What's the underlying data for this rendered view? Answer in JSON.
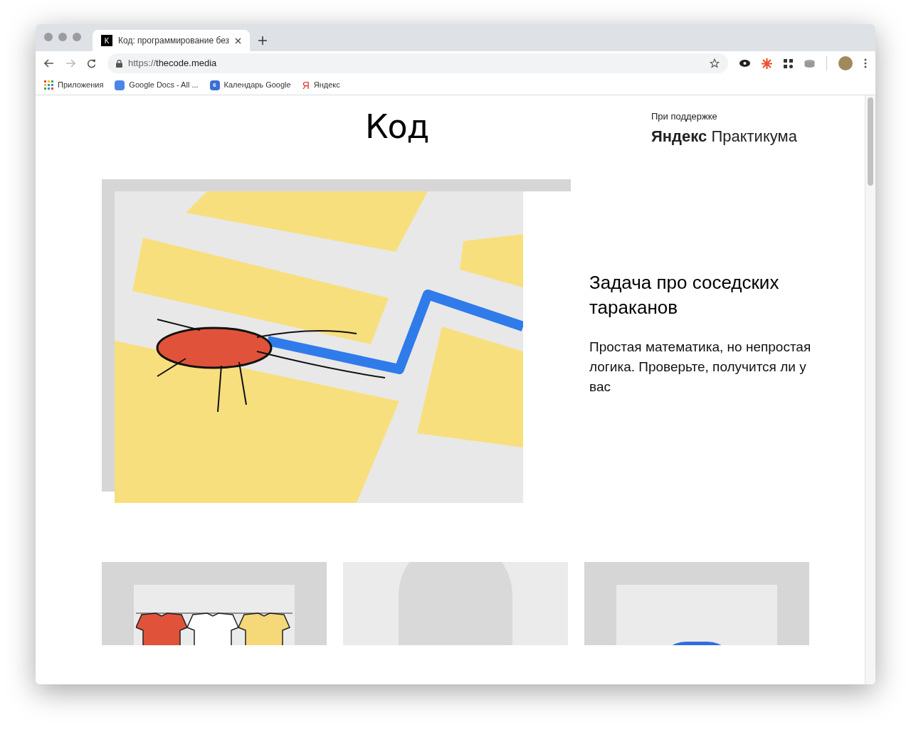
{
  "browser": {
    "tab": {
      "favicon": "K",
      "title": "Код: программирование без"
    },
    "address": {
      "scheme": "https://",
      "host": "thecode.media"
    },
    "bookmarks": [
      {
        "kind": "apps",
        "label": "Приложения"
      },
      {
        "kind": "docs",
        "label": "Google Docs - All ..."
      },
      {
        "kind": "calendar",
        "icon_text": "6",
        "label": "Календарь Google"
      },
      {
        "kind": "yandex",
        "icon_text": "Я",
        "label": "Яндекс"
      }
    ]
  },
  "header": {
    "logo": "Код",
    "sponsor_caption": "При поддержке",
    "sponsor_bold": "Яндекс",
    "sponsor_light": "Практикума"
  },
  "hero": {
    "title": "Задача про соседских тараканов",
    "text": "Простая математика, но непростая логика. Проверьте, получится ли у вас"
  },
  "cards": [
    {
      "kind": "tshirts"
    },
    {
      "kind": "child"
    },
    {
      "kind": "man"
    }
  ]
}
